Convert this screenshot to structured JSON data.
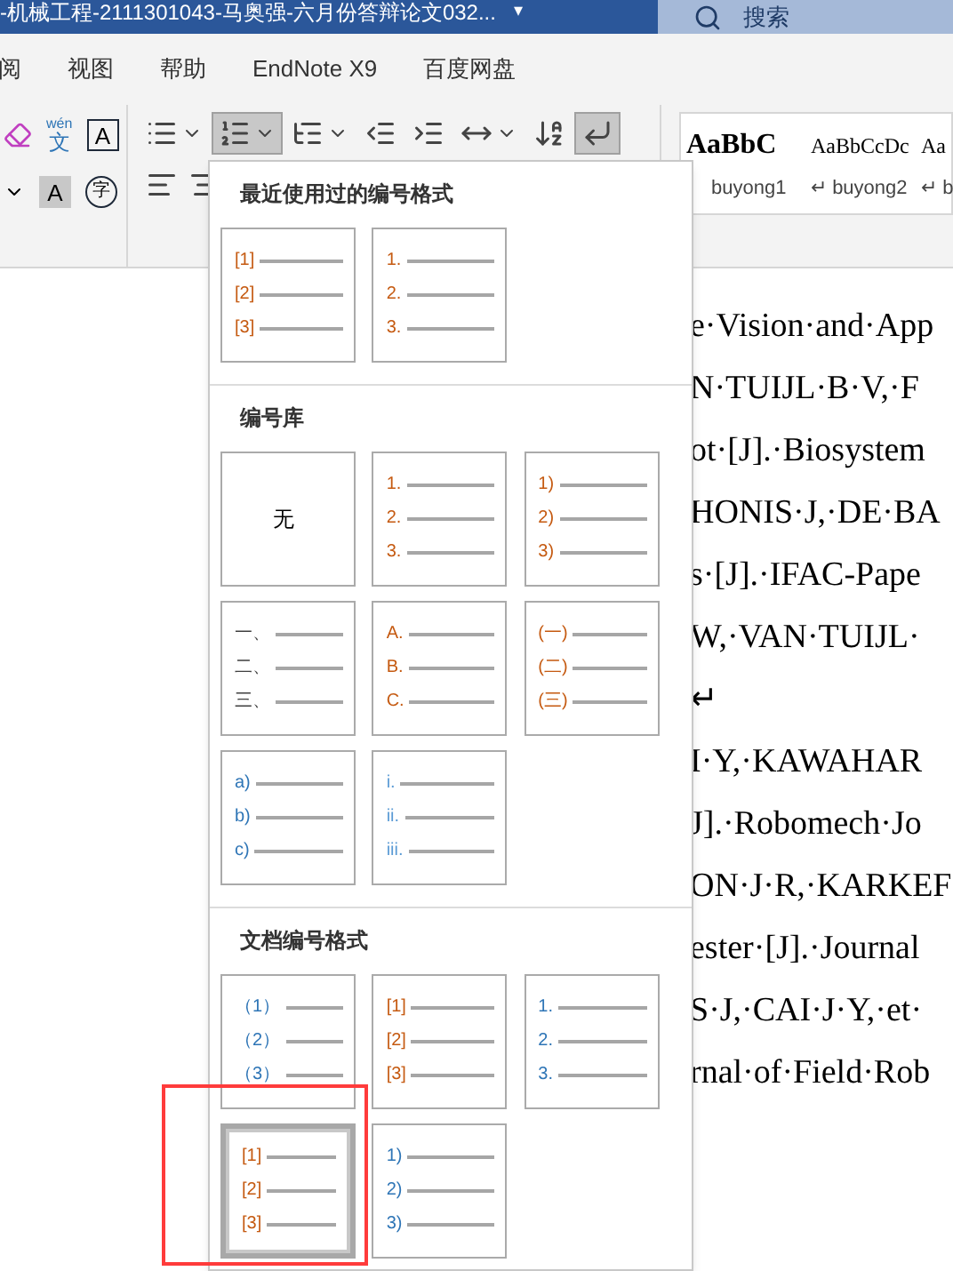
{
  "window": {
    "title": "-机械工程-2111301043-马奥强-六月份答辩论文032...",
    "title_caret": "▾",
    "search": {
      "placeholder": "搜索"
    }
  },
  "menu": [
    {
      "label": "阅",
      "selected": false
    },
    {
      "label": "视图",
      "selected": false
    },
    {
      "label": "帮助",
      "selected": false
    },
    {
      "label": "EndNote X9",
      "selected": false
    },
    {
      "label": "百度网盘",
      "selected": false
    }
  ],
  "ribbon": {
    "font_row1": [
      {
        "kind": "eraser"
      },
      {
        "kind": "phonetic",
        "top": "wén",
        "bottom": "文"
      },
      {
        "kind": "boxed",
        "text": "A"
      }
    ],
    "font_row2": [
      {
        "kind": "caret"
      },
      {
        "kind": "shaded",
        "text": "A"
      },
      {
        "kind": "circled",
        "text": "字"
      }
    ],
    "para_row1": [
      {
        "kind": "bullets",
        "selected": false
      },
      {
        "kind": "numbering",
        "selected": true
      },
      {
        "kind": "multilevel",
        "selected": false
      },
      {
        "kind": "outdent",
        "selected": false
      },
      {
        "kind": "indent",
        "selected": false
      },
      {
        "kind": "direction",
        "selected": false
      },
      {
        "kind": "sort",
        "selected": false
      },
      {
        "kind": "marks",
        "selected": true
      }
    ],
    "para_row2": [
      {
        "kind": "align-left"
      },
      {
        "kind": "align-center"
      }
    ],
    "styles": [
      {
        "sample": "AaBbC",
        "name": "buyong1"
      },
      {
        "sample": "AaBbCcDc",
        "name": "buyong2",
        "mark": "↵"
      },
      {
        "sample": "Aa",
        "name": "b",
        "mark": "↵"
      }
    ]
  },
  "document": {
    "lines": [
      "e·Vision·and·App",
      "N·TUIJL·B·V,·F",
      "ot·[J].·Biosystem",
      "HONIS·J,·DE·BA",
      "s·[J].·IFAC-Pape",
      "W,·VAN·TUIJL·",
      "↵",
      "I·Y,·KAWAHAR",
      "J].·Robomech·Jo",
      "ON·J·R,·KARKEF",
      "ester·[J].·Journal",
      "S·J,·CAI·J·Y,·et·",
      "rnal·of·Field·Rob"
    ]
  },
  "numbering_menu": {
    "sections": [
      {
        "title": "最近使用过的编号格式",
        "items": [
          {
            "kind": "list",
            "selected": false,
            "color": "#c55a11",
            "labels": [
              "[1]",
              "[2]",
              "[3]"
            ]
          },
          {
            "kind": "list",
            "selected": false,
            "color": "#c55a11",
            "labels": [
              "1.",
              "2.",
              "3."
            ]
          }
        ]
      },
      {
        "title": "编号库",
        "items": [
          {
            "kind": "none",
            "selected": false,
            "text": "无"
          },
          {
            "kind": "list",
            "selected": false,
            "color": "#c55a11",
            "labels": [
              "1.",
              "2.",
              "3."
            ]
          },
          {
            "kind": "list",
            "selected": false,
            "color": "#c55a11",
            "labels": [
              "1)",
              "2)",
              "3)"
            ]
          },
          {
            "kind": "list",
            "selected": false,
            "color": "#404040",
            "labels": [
              "一、",
              "二、",
              "三、"
            ]
          },
          {
            "kind": "list",
            "selected": false,
            "color": "#c55a11",
            "labels": [
              "A.",
              "B.",
              "C."
            ]
          },
          {
            "kind": "list",
            "selected": false,
            "color": "#c55a11",
            "labels": [
              "(一)",
              "(二)",
              "(三)"
            ]
          },
          {
            "kind": "list",
            "selected": false,
            "color": "#2e75b6",
            "labels": [
              "a)",
              "b)",
              "c)"
            ]
          },
          {
            "kind": "list",
            "selected": false,
            "color": "#5b9bd5",
            "labels": [
              "i.",
              "ii.",
              "iii."
            ]
          }
        ]
      },
      {
        "title": "文档编号格式",
        "items": [
          {
            "kind": "list",
            "selected": false,
            "color": "#2e75b6",
            "labels": [
              "（1）",
              "（2）",
              "（3）"
            ]
          },
          {
            "kind": "list",
            "selected": false,
            "color": "#c55a11",
            "labels": [
              "[1]",
              "[2]",
              "[3]"
            ]
          },
          {
            "kind": "list",
            "selected": false,
            "color": "#2e75b6",
            "labels": [
              "1.",
              "2.",
              "3."
            ]
          },
          {
            "kind": "list",
            "selected": true,
            "color": "#c55a11",
            "labels": [
              "[1]",
              "[2]",
              "[3]"
            ]
          },
          {
            "kind": "list",
            "selected": false,
            "color": "#2e75b6",
            "labels": [
              "1)",
              "2)",
              "3)"
            ]
          }
        ]
      }
    ]
  }
}
